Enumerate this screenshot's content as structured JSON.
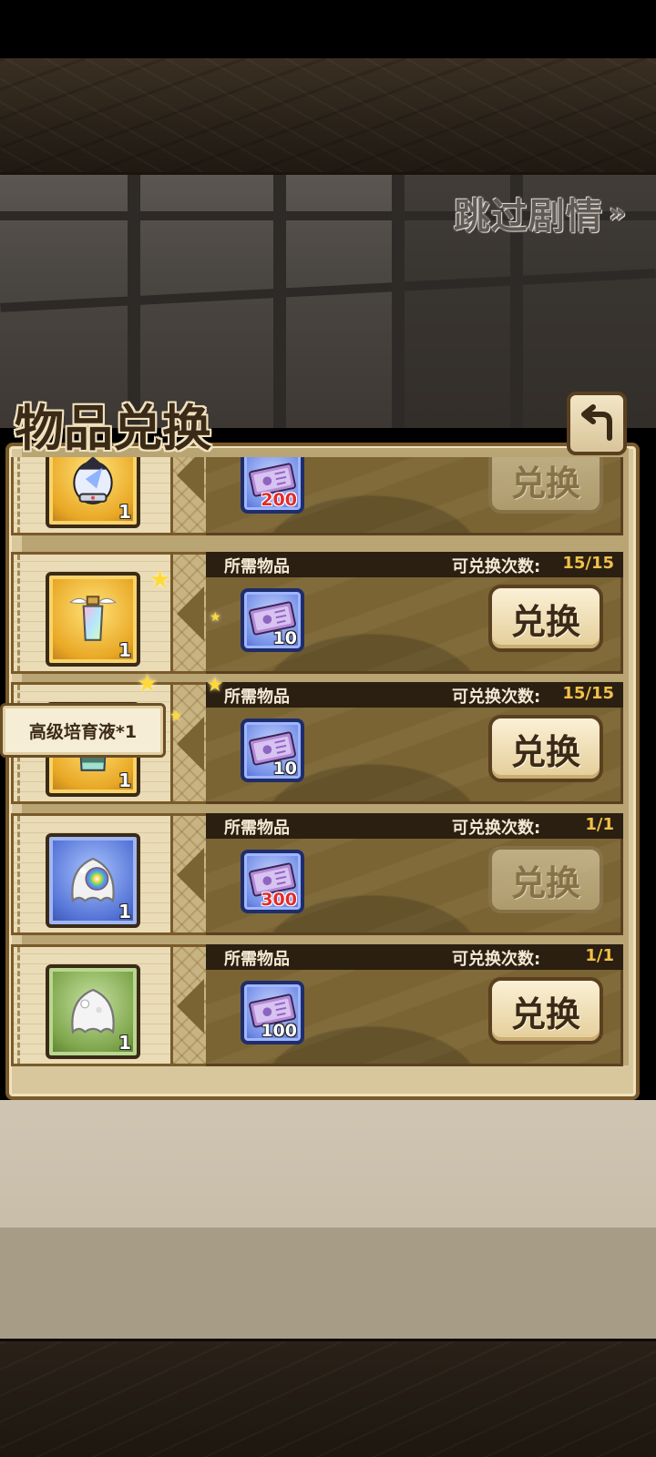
{
  "header": {
    "skip_label": "跳过剧情",
    "skip_chevron": "»",
    "panel_title": "物品兑换"
  },
  "icons": {
    "back": "back-arrow-icon",
    "cost": "purple-ticket-icon"
  },
  "colors": {
    "gold_frame": "#e9a825",
    "blue_frame": "#5574d6",
    "green_frame": "#7ea54b",
    "count_value": "#f2c14a",
    "cost_red": "#e52a2a"
  },
  "tooltip": {
    "text": "高级培育液*1"
  },
  "rows": [
    {
      "frame": "gold",
      "reward_icon": "character-portrait-icon",
      "reward_qty": "1",
      "show_header": false,
      "required_label": "",
      "count_label": "",
      "count_value": "",
      "cost_icon": "purple-ticket-icon",
      "cost_value": "200",
      "cost_red": true,
      "button_label": "兑换",
      "button_enabled": false
    },
    {
      "frame": "gold",
      "reward_icon": "winged-potion-icon",
      "reward_qty": "1",
      "show_header": true,
      "required_label": "所需物品",
      "count_label": "可兑换次数:",
      "count_value": "15/15",
      "cost_icon": "purple-ticket-icon",
      "cost_value": "10",
      "cost_red": false,
      "button_label": "兑换",
      "button_enabled": true
    },
    {
      "frame": "gold",
      "reward_icon": "potion-bottle-icon",
      "reward_qty": "1",
      "show_header": true,
      "required_label": "所需物品",
      "count_label": "可兑换次数:",
      "count_value": "15/15",
      "cost_icon": "purple-ticket-icon",
      "cost_value": "10",
      "cost_red": false,
      "button_label": "兑换",
      "button_enabled": true
    },
    {
      "frame": "blue",
      "reward_icon": "rainbow-slime-icon",
      "reward_qty": "1",
      "show_header": true,
      "required_label": "所需物品",
      "count_label": "可兑换次数:",
      "count_value": "1/1",
      "cost_icon": "purple-ticket-icon",
      "cost_value": "300",
      "cost_red": true,
      "button_label": "兑换",
      "button_enabled": false
    },
    {
      "frame": "green",
      "reward_icon": "white-slime-icon",
      "reward_qty": "1",
      "show_header": true,
      "required_label": "所需物品",
      "count_label": "可兑换次数:",
      "count_value": "1/1",
      "cost_icon": "purple-ticket-icon",
      "cost_value": "100",
      "cost_red": false,
      "button_label": "兑换",
      "button_enabled": true
    }
  ]
}
